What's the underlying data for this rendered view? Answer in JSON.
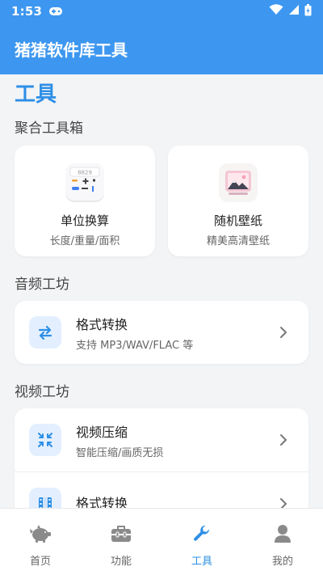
{
  "status": {
    "time": "1:53"
  },
  "app": {
    "title": "猪猪软件库工具"
  },
  "page": {
    "title": "工具"
  },
  "sections": [
    {
      "title": "聚合工具箱"
    },
    {
      "title": "音频工坊"
    },
    {
      "title": "视频工坊"
    }
  ],
  "toolbox": [
    {
      "name": "单位换算",
      "desc": "长度/重量/面积",
      "icon": "calculator-icon",
      "calc_display": "8829",
      "calc_symbols": "+ - ÷ %"
    },
    {
      "name": "随机壁纸",
      "desc": "精美高清壁纸",
      "icon": "wallpaper-icon"
    }
  ],
  "audio": [
    {
      "name": "格式转换",
      "desc": "支持 MP3/WAV/FLAC 等",
      "icon": "swap-arrows-icon"
    }
  ],
  "video": [
    {
      "name": "视频压缩",
      "desc": "智能压缩/画质无损",
      "icon": "compress-icon"
    },
    {
      "name": "格式转换",
      "desc": "",
      "icon": "film-icon"
    }
  ],
  "nav": [
    {
      "label": "首页",
      "icon": "piggy-bank-icon",
      "active": false
    },
    {
      "label": "功能",
      "icon": "toolbox-icon",
      "active": false
    },
    {
      "label": "工具",
      "icon": "wrench-icon",
      "active": true
    },
    {
      "label": "我的",
      "icon": "user-icon",
      "active": false
    }
  ],
  "colors": {
    "primary": "#3d97f0",
    "accent": "#2d8fe6",
    "background": "#f3f4f6",
    "icon_bg": "#e3efff",
    "nav_inactive": "#8a8a8a"
  }
}
